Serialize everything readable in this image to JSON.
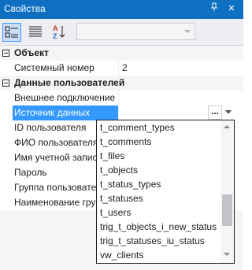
{
  "window": {
    "title": "Свойства",
    "pin_glyph": "ᵖ",
    "close_glyph": "✕"
  },
  "toolbar": {
    "buttons": [
      {
        "icon": "categorized-icon",
        "active": true
      },
      {
        "icon": "alphabetical-list-icon",
        "active": false
      },
      {
        "icon": "sort-az-icon",
        "active": false
      }
    ]
  },
  "grid": {
    "categories": [
      {
        "label": "Объект"
      },
      {
        "label": "Данные пользователей"
      }
    ],
    "properties": [
      {
        "name": "Системный номер",
        "value": "2"
      },
      {
        "name": "Внешнее подключение",
        "value": ""
      },
      {
        "name": "Источник данных",
        "value": ""
      },
      {
        "name": "ID пользователя",
        "value": ""
      },
      {
        "name": "ФИО пользователя",
        "value": ""
      },
      {
        "name": "Имя учетной записи",
        "value": ""
      },
      {
        "name": "Пароль",
        "value": ""
      },
      {
        "name": "Группа пользователя",
        "value": ""
      },
      {
        "name": "Наименование группы",
        "value": ""
      }
    ],
    "ellipsis": "..."
  },
  "dropdown": {
    "items": [
      "t_comment_types",
      "t_comments",
      "t_files",
      "t_objects",
      "t_status_types",
      "t_statuses",
      "t_users",
      "trig_t_objects_i_new_status",
      "trig_t_statuses_iu_status",
      "vw_clients"
    ]
  },
  "colors": {
    "accent": "#0e70c0",
    "selection": "#3399ff"
  }
}
